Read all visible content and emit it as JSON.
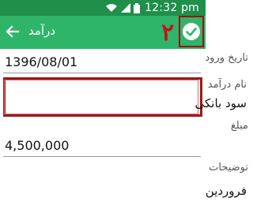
{
  "status_bar": {
    "time": "12:32 pm",
    "icons": [
      "wifi-icon",
      "signal-icon",
      "battery-icon"
    ]
  },
  "app_bar": {
    "title": "درآمد",
    "annotation_number": "۲",
    "confirm_icon": "check-circle-icon",
    "back_icon": "arrow-back-icon"
  },
  "fields": [
    {
      "label": "تاریخ ورود",
      "value": "1396/08/01"
    },
    {
      "label": "نام درآمد",
      "value": "سود بانکی"
    },
    {
      "label": "مبلغ",
      "value": "4,500,000"
    },
    {
      "label": "توضیحات",
      "value": "فروردین"
    }
  ],
  "colors": {
    "status_bar": "#1f8f4a",
    "app_bar": "#2fb569",
    "annotation": "#c0141c",
    "highlight_border": "#9a1a1e"
  }
}
